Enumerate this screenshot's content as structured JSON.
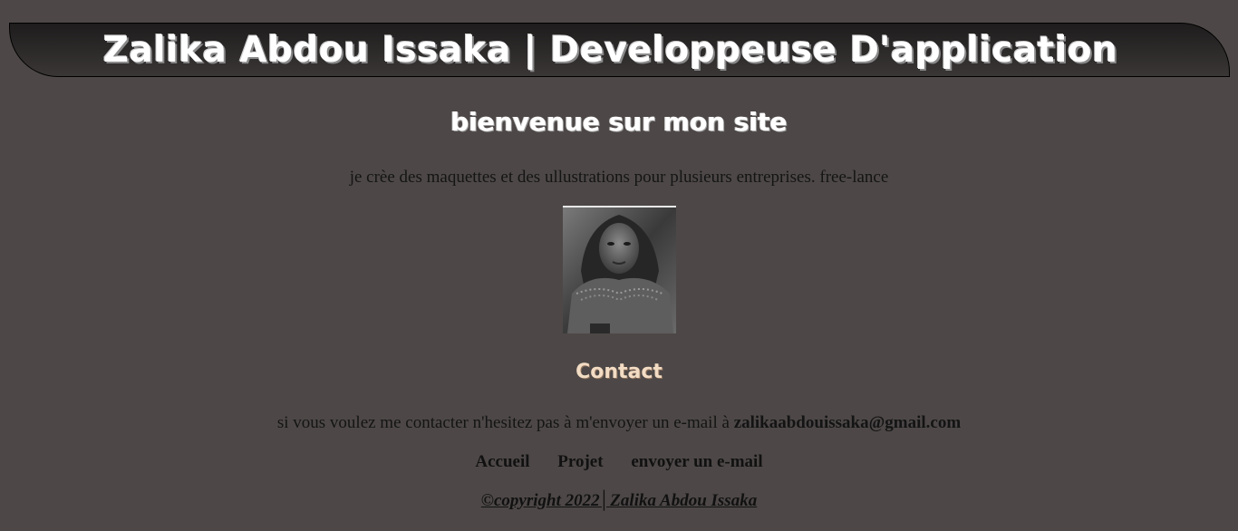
{
  "header": {
    "title": "Zalika Abdou Issaka | Developpeuse D'application"
  },
  "hero": {
    "heading": "bienvenue sur mon site",
    "intro": "je crèe des maquettes et des ullustrations pour plusieurs entreprises. free-lance"
  },
  "contact": {
    "heading": "Contact",
    "text": "si vous voulez me contacter n'hesitez pas à m'envoyer un e-mail à ",
    "email": "zalikaabdouissaka@gmail.com"
  },
  "nav": {
    "items": [
      "Accueil",
      "Projet",
      "envoyer un e-mail"
    ]
  },
  "footer": {
    "text": "©copyright 2022│Zalika Abdou Issaka"
  },
  "colors": {
    "background": "#4d4847",
    "banner": "#1e1c1c",
    "heading_text": "#ffffff",
    "contact_heading": "#f3dcc4"
  }
}
